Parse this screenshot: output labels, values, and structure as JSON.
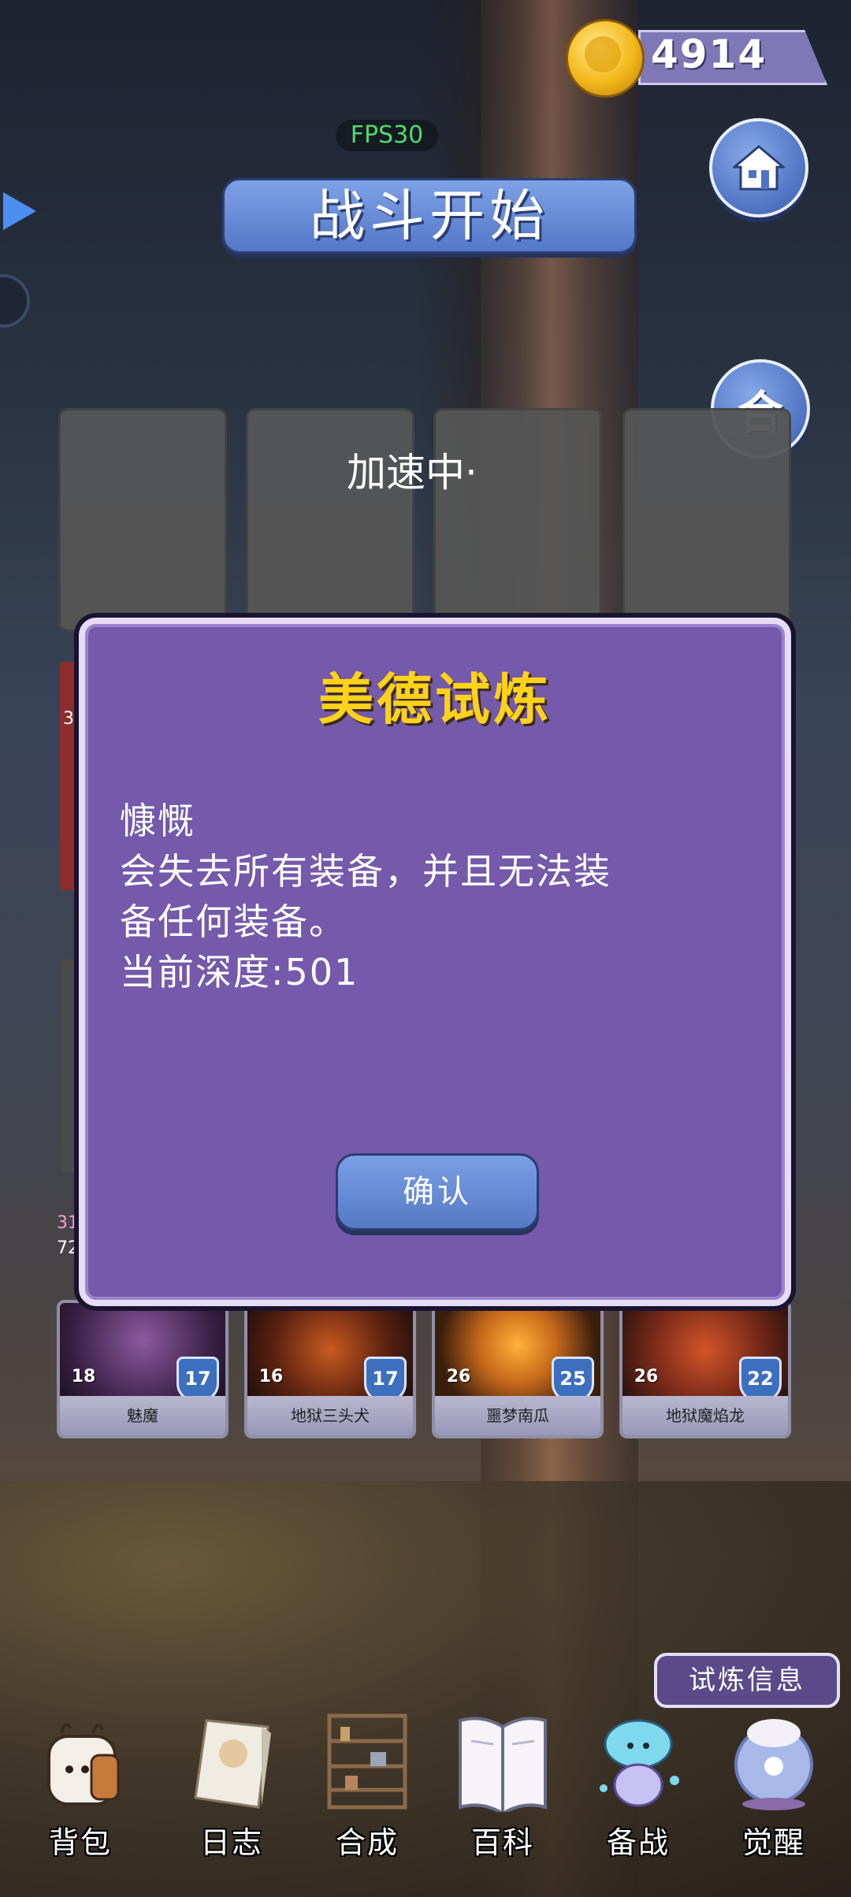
{
  "hud": {
    "coins": "4914",
    "fps": "FPS30",
    "battle_start": "战斗开始",
    "merge_label": "合",
    "speed_status": "加速中·"
  },
  "dialog": {
    "title": "美德试炼",
    "line1": "慷慨",
    "line2": "会失去所有装备，并且无法装",
    "line3": "备任何装备。",
    "line4": "当前深度:501",
    "confirm": "确认"
  },
  "cards": [
    {
      "name": "魅魔",
      "atk": "18",
      "def": "17",
      "color": "#6b3a7a"
    },
    {
      "name": "地狱三头犬",
      "atk": "16",
      "def": "17",
      "color": "#8a3a1a"
    },
    {
      "name": "噩梦南瓜",
      "atk": "26",
      "def": "25",
      "color": "#c4681a"
    },
    {
      "name": "地狱魔焰龙",
      "atk": "26",
      "def": "22",
      "color": "#7a2a18"
    }
  ],
  "peek_numbers": {
    "a": "3",
    "b": "31",
    "c": "72"
  },
  "trial_info": "试炼信息",
  "nav": [
    {
      "label": "背包",
      "icon": "backpack-icon"
    },
    {
      "label": "日志",
      "icon": "log-icon"
    },
    {
      "label": "合成",
      "icon": "crafting-icon"
    },
    {
      "label": "百科",
      "icon": "encyclopedia-icon"
    },
    {
      "label": "备战",
      "icon": "prepare-icon"
    },
    {
      "label": "觉醒",
      "icon": "awaken-icon"
    }
  ],
  "colors": {
    "accent": "#5477c8",
    "dialog": "#7559ab",
    "title_gold": "#ffd21a",
    "fps": "#4ddc6a"
  }
}
